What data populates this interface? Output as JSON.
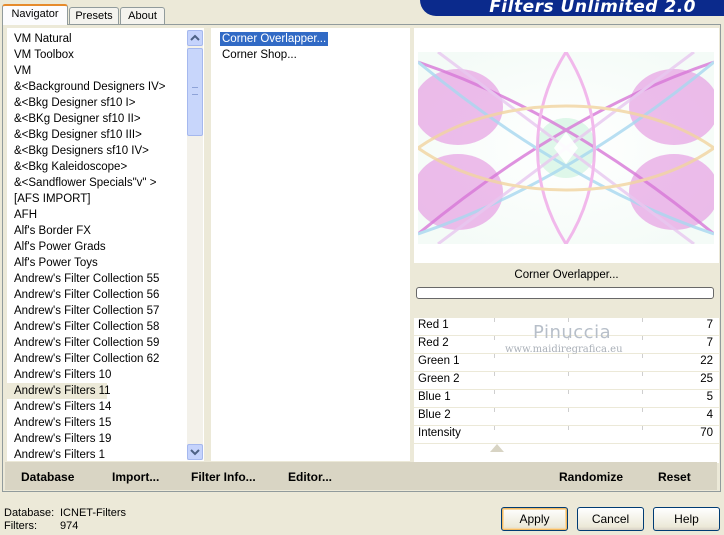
{
  "tabs": [
    {
      "label": "Navigator",
      "active": true
    },
    {
      "label": "Presets",
      "active": false
    },
    {
      "label": "About",
      "active": false
    }
  ],
  "app_title": "Filters Unlimited 2.0",
  "categories": [
    "VM Natural",
    "VM Toolbox",
    "VM",
    "&<Background Designers IV>",
    "&<Bkg Designer sf10 I>",
    "&<BKg Designer sf10 II>",
    "&<Bkg Designer sf10 III>",
    "&<Bkg Designers sf10 IV>",
    "&<Bkg Kaleidoscope>",
    "&<Sandflower Specials\"v\" >",
    "[AFS IMPORT]",
    "AFH",
    "Alf's Border FX",
    "Alf's Power Grads",
    "Alf's Power Toys",
    "Andrew's Filter Collection 55",
    "Andrew's Filter Collection 56",
    "Andrew's Filter Collection 57",
    "Andrew's Filter Collection 58",
    "Andrew's Filter Collection 59",
    "Andrew's Filter Collection 62",
    "Andrew's Filters 10",
    "Andrew's Filters 11",
    "Andrew's Filters 14",
    "Andrew's Filters 15",
    "Andrew's Filters 19",
    "Andrew's Filters 1"
  ],
  "selected_category": "Andrew's Filters 11",
  "filters": [
    "Corner Overlapper...",
    "Corner Shop..."
  ],
  "selected_filter": "Corner Overlapper...",
  "filter_name": "Corner Overlapper...",
  "params": [
    {
      "label": "Red 1",
      "value": "7"
    },
    {
      "label": "Red 2",
      "value": "7"
    },
    {
      "label": "Green 1",
      "value": "22"
    },
    {
      "label": "Green 2",
      "value": "25"
    },
    {
      "label": "Blue 1",
      "value": "5"
    },
    {
      "label": "Blue 2",
      "value": "4"
    },
    {
      "label": "Intensity",
      "value": "70"
    }
  ],
  "watermark": {
    "name": "Pinuccia",
    "site": "www.maidiregrafica.eu"
  },
  "buttons": {
    "database": "Database",
    "import": "Import...",
    "filter_info": "Filter Info...",
    "editor": "Editor...",
    "randomize": "Randomize",
    "reset": "Reset",
    "apply": "Apply",
    "cancel": "Cancel",
    "help": "Help"
  },
  "status": {
    "database_label": "Database:",
    "database_value": "ICNET-Filters",
    "filters_label": "Filters:",
    "filters_value": "974"
  },
  "colors": {
    "selection": "#316ac5",
    "banner": "#0b2a8c",
    "default_button_glow": "#f2b962"
  }
}
